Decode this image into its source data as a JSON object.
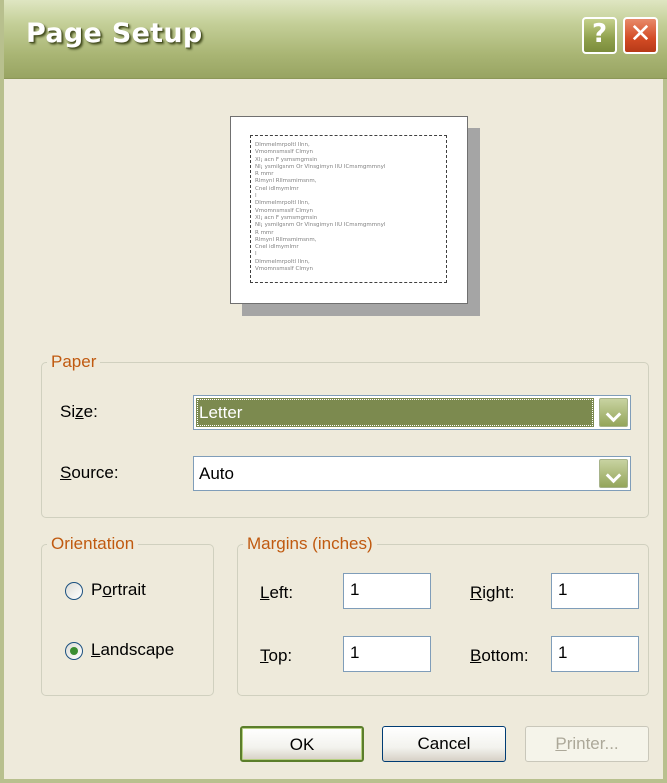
{
  "window": {
    "title": "Page Setup",
    "help_glyph": "?",
    "close_glyph": "✕"
  },
  "preview": {
    "lines": [
      "Dlmmelmrpoltl Ilnn,",
      "Vmomnsmsslf Clmyn",
      "Xl¡ acn F ysmsmgmsin",
      "Nl¡ ysmilgsnm Or Vlnsgimyn IlU ICmsmgmmnyl",
      "R mmr",
      "Rlmynl  Rllmsmimsnm,",
      "Cnel idlmymlmr",
      "I",
      "Dlmmelmrpoltl Ilnn,",
      "Vmomnsmsslf Clmyn",
      "Xl¡ acn F ysmsmgmsin",
      "Nl¡ ysmilgsnm Or Vlnsgimyn IlU ICmsmgmmnyl",
      "R mmr",
      "Rlmynl  Rllmsmimsnm,",
      "Cnel idlmymlmr",
      "I",
      "Dlmmelmrpoltl Ilnn,",
      "Vmomnsmsslf Clmyn"
    ]
  },
  "paper": {
    "legend": "Paper",
    "size_label_pre": "Si",
    "size_label_ul": "z",
    "size_label_post": "e:",
    "size_value": "Letter",
    "source_label_ul": "S",
    "source_label_post": "ource:",
    "source_value": "Auto"
  },
  "orientation": {
    "legend": "Orientation",
    "portrait_pre": "P",
    "portrait_ul": "o",
    "portrait_post": "rtrait",
    "landscape_pre": "",
    "landscape_ul": "L",
    "landscape_post": "andscape",
    "selected": "landscape"
  },
  "margins": {
    "legend": "Margins (inches)",
    "left_ul": "L",
    "left_post": "eft:",
    "left_value": "1",
    "right_ul": "R",
    "right_post": "ight:",
    "right_value": "1",
    "top_ul": "T",
    "top_post": "op:",
    "top_value": "1",
    "bottom_ul": "B",
    "bottom_post": "ottom:",
    "bottom_value": "1"
  },
  "buttons": {
    "ok": "OK",
    "cancel": "Cancel",
    "printer_ul": "P",
    "printer_post": "rinter..."
  }
}
